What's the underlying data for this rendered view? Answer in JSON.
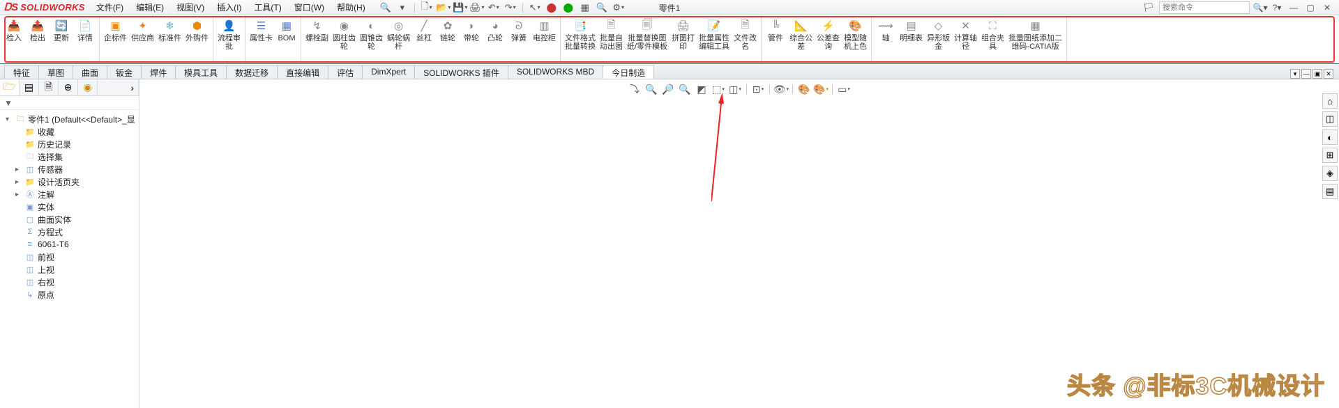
{
  "app": {
    "logo_initial": "S",
    "logo_text": "SOLIDWORKS"
  },
  "menu": [
    "文件(F)",
    "编辑(E)",
    "视图(V)",
    "插入(I)",
    "工具(T)",
    "窗口(W)",
    "帮助(H)"
  ],
  "doc_title": "零件1",
  "search": {
    "placeholder": "搜索命令"
  },
  "ribbon": [
    {
      "items": [
        {
          "label": "检入",
          "icon": "📥",
          "color": "#c33"
        },
        {
          "label": "检出",
          "icon": "📤",
          "color": "#c33"
        },
        {
          "label": "更新",
          "icon": "🔄",
          "color": "#36c"
        },
        {
          "label": "详情",
          "icon": "📄",
          "color": "#c66"
        }
      ]
    },
    {
      "items": [
        {
          "label": "企标件",
          "icon": "▣",
          "color": "#e80"
        },
        {
          "label": "供应商",
          "icon": "✦",
          "color": "#e80"
        },
        {
          "label": "标准件",
          "icon": "❄",
          "color": "#5bd"
        },
        {
          "label": "外购件",
          "icon": "⬢",
          "color": "#e80"
        }
      ]
    },
    {
      "items": [
        {
          "label": "流程审\n批",
          "icon": "👤",
          "color": "#888"
        }
      ]
    },
    {
      "items": [
        {
          "label": "属性卡",
          "icon": "☰",
          "color": "#57c"
        },
        {
          "label": "BOM",
          "icon": "▦",
          "color": "#57c"
        }
      ]
    },
    {
      "items": [
        {
          "label": "螺栓副",
          "icon": "↯",
          "color": "#888"
        },
        {
          "label": "圆柱齿\n轮",
          "icon": "◉",
          "color": "#888"
        },
        {
          "label": "圆锥齿\n轮",
          "icon": "◐",
          "color": "#888"
        },
        {
          "label": "蜗轮蜗\n杆",
          "icon": "◎",
          "color": "#888"
        },
        {
          "label": "丝杠",
          "icon": "╱",
          "color": "#888"
        },
        {
          "label": "链轮",
          "icon": "✿",
          "color": "#888"
        },
        {
          "label": "带轮",
          "icon": "◗",
          "color": "#888"
        },
        {
          "label": "凸轮",
          "icon": "◕",
          "color": "#888"
        },
        {
          "label": "弹簧",
          "icon": "ᘐ",
          "color": "#888"
        },
        {
          "label": "电控柜",
          "icon": "▥",
          "color": "#888"
        }
      ]
    },
    {
      "items": [
        {
          "label": "文件格式\n批量转换",
          "icon": "📑",
          "color": "#888"
        },
        {
          "label": "批量自\n动出图",
          "icon": "🖹",
          "color": "#888"
        },
        {
          "label": "批量替换图\n纸/零件模板",
          "icon": "🗐",
          "color": "#888"
        },
        {
          "label": "拼图打\n印",
          "icon": "🖨",
          "color": "#888"
        },
        {
          "label": "批量属性\n编辑工具",
          "icon": "📝",
          "color": "#888"
        },
        {
          "label": "文件改\n名",
          "icon": "🗎",
          "color": "#888"
        }
      ]
    },
    {
      "items": [
        {
          "label": "管件",
          "icon": "╚",
          "color": "#888"
        },
        {
          "label": "综合公\n差",
          "icon": "📐",
          "color": "#888"
        },
        {
          "label": "公差查\n询",
          "icon": "⚡",
          "color": "#888"
        },
        {
          "label": "模型随\n机上色",
          "icon": "🎨",
          "color": "#e80"
        }
      ]
    },
    {
      "items": [
        {
          "label": "轴",
          "icon": "⟿",
          "color": "#888"
        },
        {
          "label": "明细表",
          "icon": "▤",
          "color": "#888"
        },
        {
          "label": "异形钣\n金",
          "icon": "◇",
          "color": "#888"
        },
        {
          "label": "计算轴\n径",
          "icon": "✕",
          "color": "#888"
        },
        {
          "label": "组合夹\n具",
          "icon": "⛶",
          "color": "#888"
        },
        {
          "label": "批量图纸添加二\n维码-CATIA版",
          "icon": "▦",
          "color": "#888"
        }
      ]
    }
  ],
  "tabs": [
    "特征",
    "草图",
    "曲面",
    "钣金",
    "焊件",
    "模具工具",
    "数据迁移",
    "直接编辑",
    "评估",
    "DimXpert",
    "SOLIDWORKS 插件",
    "SOLIDWORKS MBD",
    "今日制造"
  ],
  "tabs_active": 12,
  "tree": {
    "root": "零件1 (Default<<Default>_显",
    "items": [
      {
        "icon": "📁",
        "label": "收藏",
        "color": "#d80"
      },
      {
        "icon": "📁",
        "label": "历史记录",
        "color": "#d80"
      },
      {
        "icon": "🗀",
        "label": "选择集",
        "color": "#79c"
      },
      {
        "icon": "◫",
        "label": "传感器",
        "exp": "▸",
        "color": "#79c"
      },
      {
        "icon": "📁",
        "label": "设计活页夹",
        "exp": "▸",
        "color": "#d80"
      },
      {
        "icon": "Ⓐ",
        "label": "注解",
        "exp": "▸",
        "color": "#79c"
      },
      {
        "icon": "▣",
        "label": "实体",
        "color": "#79c"
      },
      {
        "icon": "▢",
        "label": "曲面实体",
        "color": "#79c"
      },
      {
        "icon": "Σ",
        "label": "方程式",
        "color": "#79c"
      },
      {
        "icon": "≡",
        "label": "6061-T6",
        "color": "#79c"
      },
      {
        "icon": "◫",
        "label": "前视",
        "color": "#79c"
      },
      {
        "icon": "◫",
        "label": "上视",
        "color": "#79c"
      },
      {
        "icon": "◫",
        "label": "右视",
        "color": "#79c"
      },
      {
        "icon": "↳",
        "label": "原点",
        "color": "#79c"
      }
    ]
  },
  "right_rail": [
    "⌂",
    "◫",
    "◐",
    "⊞",
    "◈",
    "▤"
  ],
  "watermark": "头条 @非标3C机械设计"
}
